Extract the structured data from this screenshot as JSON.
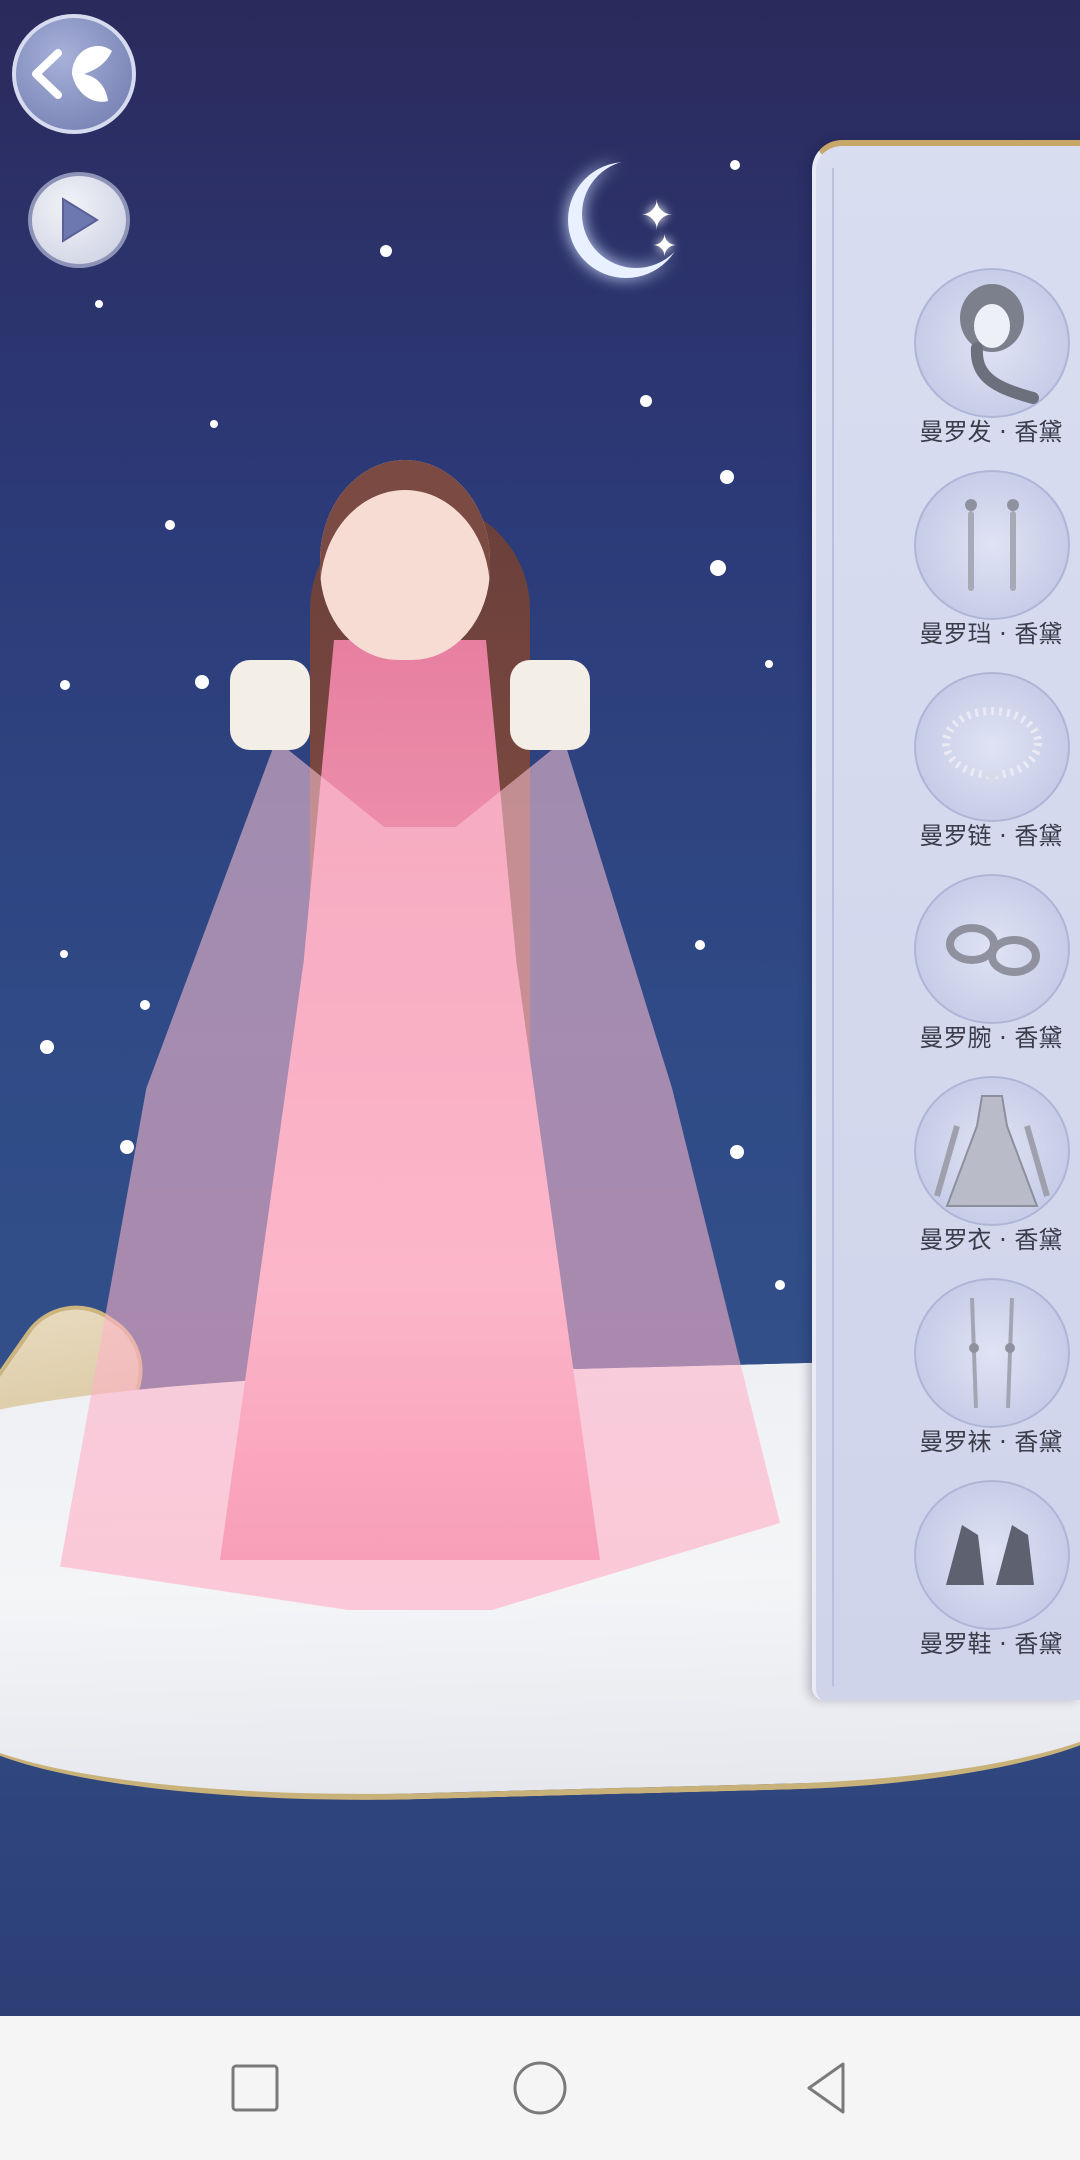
{
  "top_controls": {
    "back_icon": "butterfly-back-icon",
    "play_icon": "play-icon"
  },
  "outfit_panel": {
    "items": [
      {
        "label": "曼罗发 · 香黛",
        "icon": "hair-icon"
      },
      {
        "label": "曼罗珰 · 香黛",
        "icon": "earrings-icon"
      },
      {
        "label": "曼罗链 · 香黛",
        "icon": "necklace-icon"
      },
      {
        "label": "曼罗腕 · 香黛",
        "icon": "bracelet-icon"
      },
      {
        "label": "曼罗衣 · 香黛",
        "icon": "dress-icon"
      },
      {
        "label": "曼罗袜 · 香黛",
        "icon": "socks-icon"
      },
      {
        "label": "曼罗鞋 · 香黛",
        "icon": "shoes-icon"
      }
    ]
  },
  "nav_bar": {
    "recent_icon": "square-recents-icon",
    "home_icon": "circle-home-icon",
    "back_icon": "triangle-back-icon"
  }
}
